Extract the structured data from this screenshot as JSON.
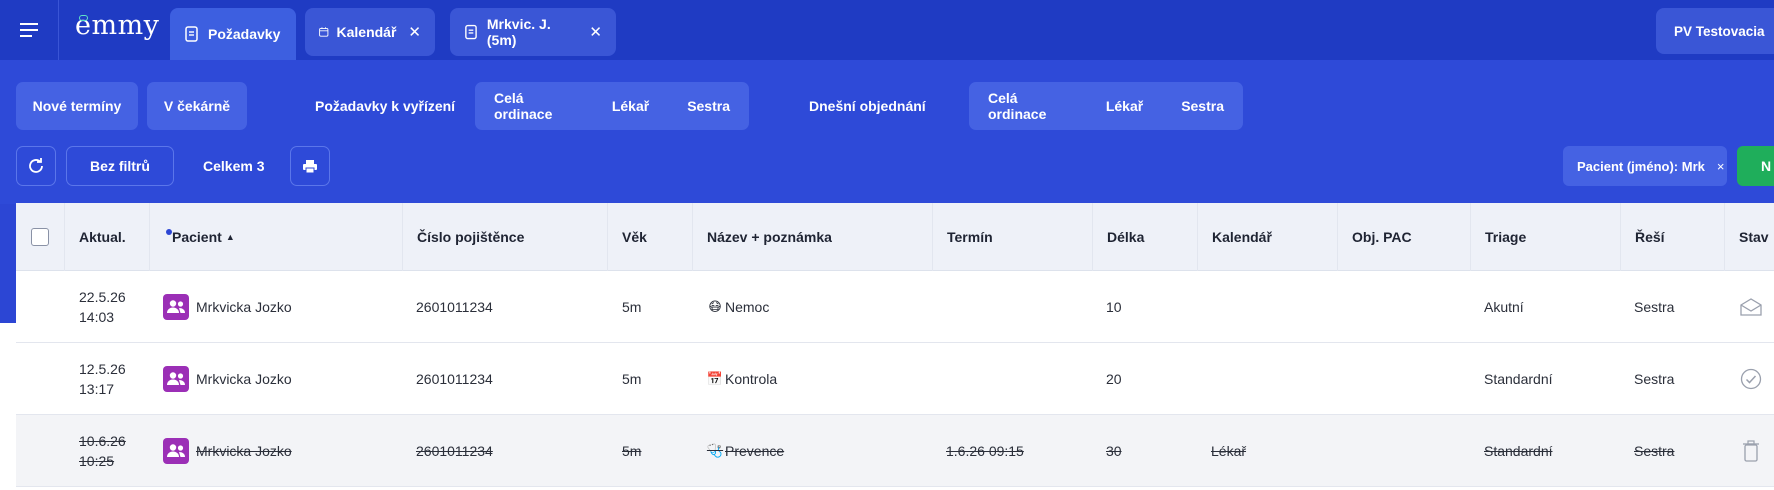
{
  "app": {
    "logo": "emmy"
  },
  "tabs": [
    {
      "label": "Požadavky",
      "active": true,
      "closable": false,
      "icon": "document-icon"
    },
    {
      "label": "Kalendář",
      "active": false,
      "closable": true,
      "icon": "calendar-icon"
    },
    {
      "label": "Mrkvic. J. (5m)",
      "active": false,
      "closable": true,
      "icon": "document-icon"
    }
  ],
  "close_glyph": "✕",
  "user": {
    "label": "PV Testovacia"
  },
  "filters": {
    "new_terms": "Nové termíny",
    "waiting": "V čekárně",
    "requests_label": "Požadavky k vyřízení",
    "requests_group": [
      "Celá ordinace",
      "Lékař",
      "Sestra"
    ],
    "today_label": "Dnešní objednání",
    "today_group": [
      "Celá ordinace",
      "Lékař",
      "Sestra"
    ]
  },
  "toolbar": {
    "no_filters": "Bez filtrů",
    "total": "Celkem 3",
    "active_filter": "Pacient (jméno): Mrk",
    "active_filter_close": "×",
    "new_button": "N"
  },
  "table": {
    "headers": [
      "Aktual.",
      "Pacient",
      "Číslo pojištěnce",
      "Věk",
      "Název + poznámka",
      "Termín",
      "Délka",
      "Kalendář",
      "Obj. PAC",
      "Triage",
      "Řeší",
      "Stav"
    ],
    "sort_indicator": "▲",
    "rows": [
      {
        "date": "22.5.26",
        "time": "14:03",
        "patient": "Mrkvicka Jozko",
        "insurance": "2601011234",
        "age": "5m",
        "emoji": "😷",
        "name": "Nemoc",
        "term": "",
        "length": "10",
        "calendar": "",
        "obj_pac": "",
        "triage": "Akutní",
        "solver": "Sestra",
        "status": "envelope-icon",
        "deleted": false
      },
      {
        "date": "12.5.26",
        "time": "13:17",
        "patient": "Mrkvicka Jozko",
        "insurance": "2601011234",
        "age": "5m",
        "emoji": "📅",
        "name": "Kontrola",
        "term": "",
        "length": "20",
        "calendar": "",
        "obj_pac": "",
        "triage": "Standardní",
        "solver": "Sestra",
        "status": "check-circle-icon",
        "deleted": false
      },
      {
        "date": "10.6.26",
        "time": "10:25",
        "patient": "Mrkvicka Jozko",
        "insurance": "2601011234",
        "age": "5m",
        "emoji": "🩺",
        "name": "Prevence",
        "term": "1.6.26 09:15",
        "length": "30",
        "calendar": "Lékař",
        "obj_pac": "",
        "triage": "Standardní",
        "solver": "Sestra",
        "status": "trash-icon",
        "deleted": true
      }
    ]
  },
  "colors": {
    "brand": "#1f3bc3",
    "panel": "#2e4ad8",
    "chip": "#4562e3",
    "avatar": "#9b2fb6",
    "green": "#1fae5b"
  }
}
